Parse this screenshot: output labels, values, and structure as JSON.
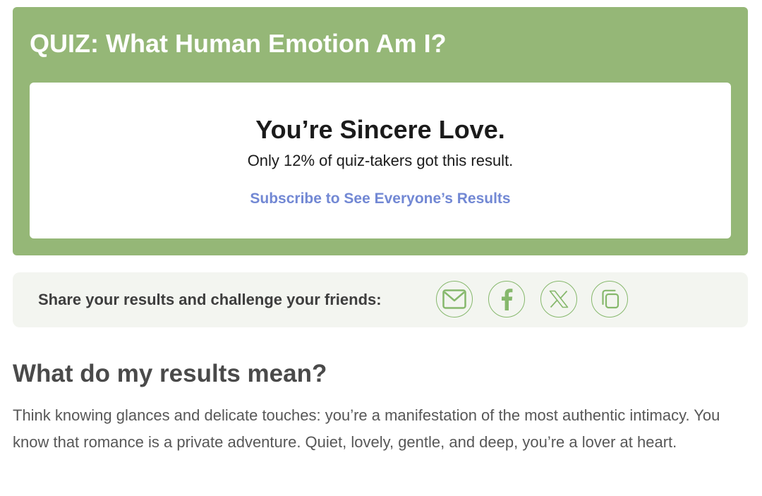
{
  "quiz": {
    "title": "QUIZ: What Human Emotion Am I?",
    "result_heading": "You’re Sincere Love.",
    "result_stat": "Only 12% of quiz-takers got this result.",
    "subscribe_label": "Subscribe to See Everyone’s Results"
  },
  "share": {
    "label": "Share your results and challenge your friends:",
    "buttons": [
      {
        "icon": "envelope-icon"
      },
      {
        "icon": "facebook-icon"
      },
      {
        "icon": "x-icon"
      },
      {
        "icon": "copy-icon"
      }
    ]
  },
  "meaning": {
    "heading": "What do my results mean?",
    "body": "Think knowing glances and delicate touches: you’re a manifestation of the most authentic intimacy. You know that romance is a private adventure. Quiet, lovely, gentle, and deep, you’re a lover at heart."
  },
  "colors": {
    "quiz_card_background": "#95b777",
    "link": "#7288d4",
    "share_icon": "#86b86c",
    "share_bar_background": "#f3f5f0"
  }
}
